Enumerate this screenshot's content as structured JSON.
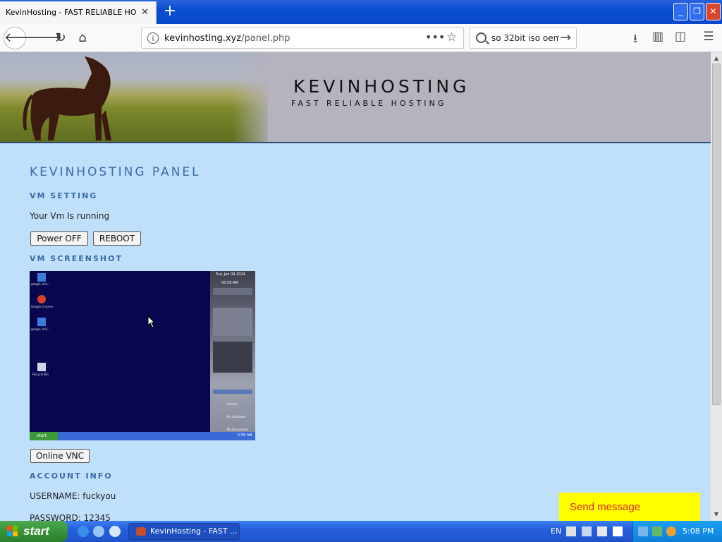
{
  "browser": {
    "tab_title": "KevinHosting - FAST RELIABLE HOSTIN",
    "tab_close": "✕",
    "new_tab": "+",
    "url_host": "kevinhosting.xyz",
    "url_path": "/panel.php",
    "search_text": "so 32bit iso oem"
  },
  "site": {
    "title": "KEVINHOSTING",
    "subtitle": "FAST RELIABLE HOSTING"
  },
  "panel": {
    "heading": "KEVINHOSTING PANEL",
    "vm_setting_heading": "VM SETTING",
    "vm_status": "Your Vm Is running",
    "power_off_label": "Power OFF",
    "reboot_label": "REBOOT",
    "vm_screenshot_heading": "VM SCREENSHOT",
    "online_vnc_label": "Online VNC",
    "account_info_heading": "ACCOUNT INFO",
    "username_line": "USERNAME: fuckyou",
    "password_line": "PASSWORD: 12345"
  },
  "vm_screenshot": {
    "date_text": "Tue, Jan 09 2024",
    "time_text": "05:59 AM",
    "start_label": "start",
    "tray_time": "5:59 AM",
    "desktop_icons": [
      "google chro...",
      "Google Chrome",
      "google chro...",
      "Recycle Bin"
    ],
    "sidebar_items": [
      "Games",
      "My Computer",
      "My Documents"
    ]
  },
  "chat": {
    "send_message_label": "Send message"
  },
  "taskbar": {
    "start_label": "start",
    "task_title": "KevinHosting - FAST ...",
    "language": "EN",
    "clock": "5:08 PM"
  }
}
